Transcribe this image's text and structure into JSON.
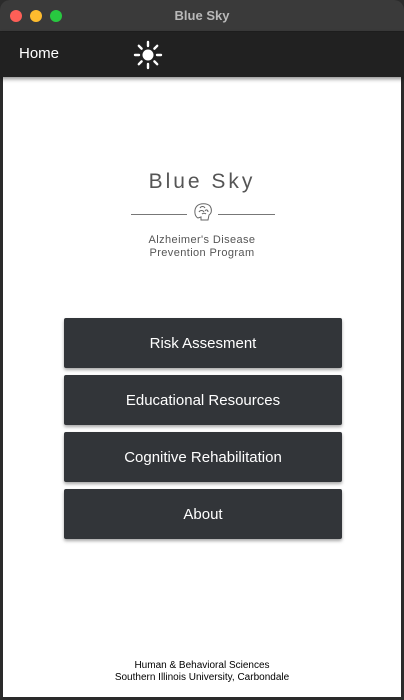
{
  "window": {
    "title": "Blue Sky"
  },
  "appbar": {
    "home_label": "Home",
    "theme_icon": "sun-icon"
  },
  "logo": {
    "title": "Blue Sky",
    "icon": "brain-icon",
    "subtitle_line1": "Alzheimer's Disease",
    "subtitle_line2": "Prevention Program"
  },
  "menu": [
    {
      "label": "Risk Assesment"
    },
    {
      "label": "Educational Resources"
    },
    {
      "label": "Cognitive Rehabilitation"
    },
    {
      "label": "About"
    }
  ],
  "footer": {
    "line1": "Human & Behavioral Sciences",
    "line2": "Southern Illinois University, Carbondale"
  },
  "colors": {
    "appbar": "#212121",
    "button": "#323539",
    "button_text": "#ffffff",
    "content_bg": "#ffffff"
  }
}
